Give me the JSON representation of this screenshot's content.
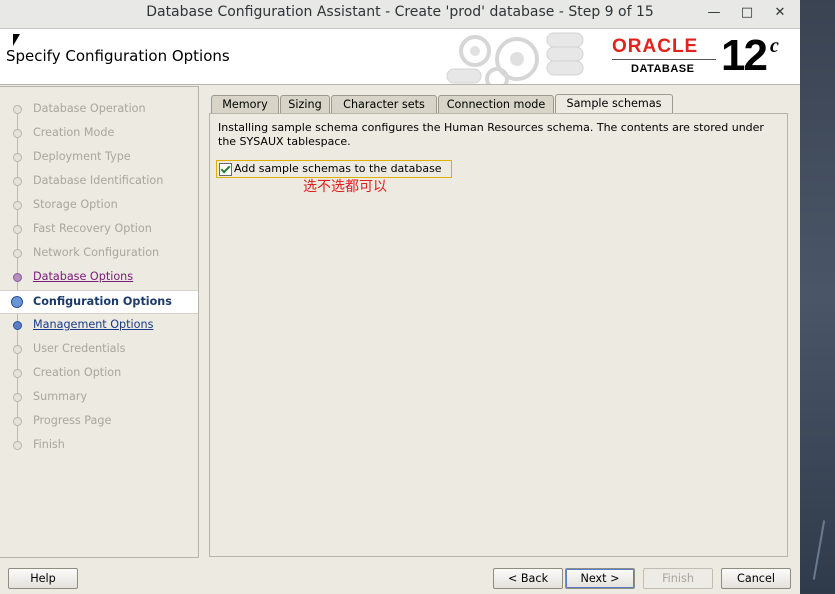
{
  "window": {
    "title": "Database Configuration Assistant - Create 'prod' database - Step 9 of 15",
    "minimize_glyph": "—",
    "maximize_glyph": "□",
    "close_glyph": "✕"
  },
  "header": {
    "page_title": "Specify Configuration Options",
    "oracle_word": "ORACLE",
    "database_word": "DATABASE",
    "version": "12",
    "version_suffix": "c"
  },
  "nav": {
    "items": [
      {
        "label": "Database Operation",
        "state": "done"
      },
      {
        "label": "Creation Mode",
        "state": "done"
      },
      {
        "label": "Deployment Type",
        "state": "done"
      },
      {
        "label": "Database Identification",
        "state": "done"
      },
      {
        "label": "Storage Option",
        "state": "done"
      },
      {
        "label": "Fast Recovery Option",
        "state": "done"
      },
      {
        "label": "Network Configuration",
        "state": "done"
      },
      {
        "label": "Database Options",
        "state": "visited"
      },
      {
        "label": "Configuration Options",
        "state": "current"
      },
      {
        "label": "Management Options",
        "state": "link"
      },
      {
        "label": "User Credentials",
        "state": "pending"
      },
      {
        "label": "Creation Option",
        "state": "pending"
      },
      {
        "label": "Summary",
        "state": "pending"
      },
      {
        "label": "Progress Page",
        "state": "pending"
      },
      {
        "label": "Finish",
        "state": "pending"
      }
    ]
  },
  "tabs": [
    {
      "label": "Memory",
      "active": false
    },
    {
      "label": "Sizing",
      "active": false
    },
    {
      "label": "Character sets",
      "active": false
    },
    {
      "label": "Connection mode",
      "active": false
    },
    {
      "label": "Sample schemas",
      "active": true
    }
  ],
  "panel": {
    "description": "Installing sample schema configures the Human Resources schema. The contents are stored under the SYSAUX tablespace.",
    "checkbox_label": "Add sample schemas to the database",
    "checkbox_checked": true,
    "annotation": "选不选都可以"
  },
  "buttons": {
    "help": "Help",
    "back": "< Back",
    "next": "Next >",
    "finish": "Finish",
    "cancel": "Cancel"
  },
  "colors": {
    "oracle_red": "#e2231a",
    "annotation_red": "#e02020",
    "visited_link": "#7a1a7a",
    "link": "#1a3a8a"
  }
}
